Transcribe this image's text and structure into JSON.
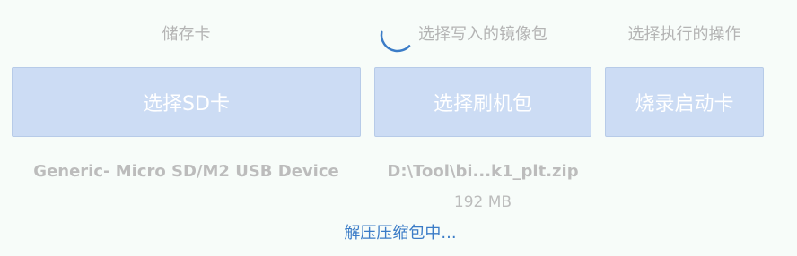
{
  "columns": {
    "storage_card": {
      "title": "储存卡",
      "button_label": "选择SD卡",
      "device_name": "Generic- Micro SD/M2 USB Device"
    },
    "image_package": {
      "title": "选择写入的镜像包",
      "button_label": "选择刷机包",
      "file_path": "D:\\Tool\\bi...k1_plt.zip",
      "file_size": "192 MB"
    },
    "action": {
      "title": "选择执行的操作",
      "button_label": "烧录启动卡"
    }
  },
  "status": {
    "text": "解压压缩包中..."
  },
  "colors": {
    "button_bg": "#ccdcf4",
    "accent": "#3b7cc7",
    "muted_text": "#b4b4b4"
  },
  "icons": {
    "spinner": "loading-spinner-icon"
  }
}
